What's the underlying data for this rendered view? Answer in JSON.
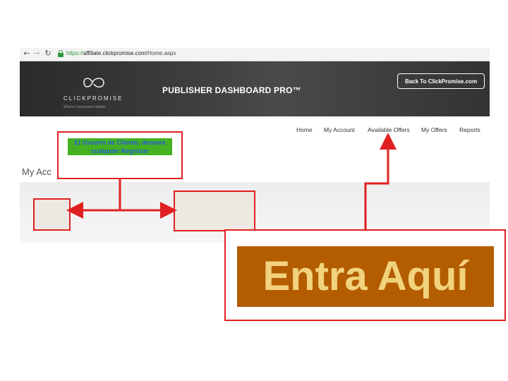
{
  "browser": {
    "url_prefix": "https://",
    "url_domain": "affiliate.clickpromise.com",
    "url_path": "/Home.aspx",
    "icons": [
      "back-arrow-icon",
      "forward-arrow-icon",
      "reload-icon",
      "lock-icon"
    ]
  },
  "banner": {
    "logo_text": "CLICKPROMISE",
    "logo_sub": "Where Conversions Matter",
    "title": "PUBLISHER DASHBOARD PRO™",
    "back_button": "Back To ClickPromise.com"
  },
  "nav": {
    "items": [
      "Home",
      "My Account",
      "Available Offers",
      "My Offers",
      "Reports"
    ]
  },
  "page": {
    "account_title": "My Acc"
  },
  "annotations": {
    "callout": "El Usuario de Cliente, deseara cualquier Registrar",
    "entry_label": "Entra Aquí",
    "colors": {
      "arrow": "#e02020",
      "callout_bg": "#43b121",
      "entry_bg": "#b45d00",
      "entry_text": "#f2d37d"
    }
  }
}
